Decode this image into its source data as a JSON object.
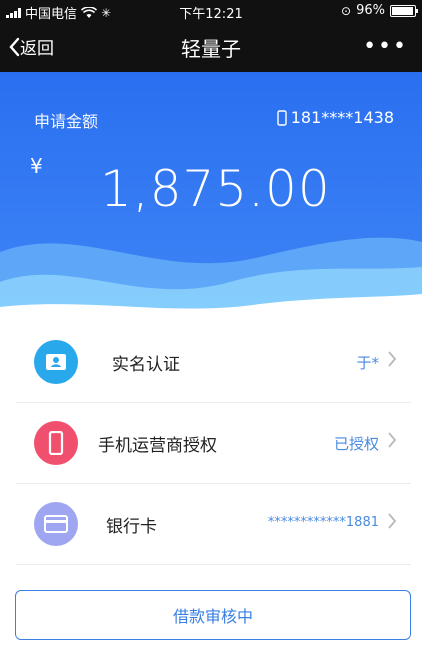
{
  "status_bar": {
    "carrier": "中国电信",
    "time": "下午12:21",
    "battery_pct": "96%",
    "battery_level": 0.96
  },
  "nav": {
    "back_label": "返回",
    "title": "轻量子",
    "more_label": "•••"
  },
  "header": {
    "label": "申请金额",
    "phone": "181****1438",
    "currency": "¥",
    "amount": "1,875.00"
  },
  "items": [
    {
      "name": "实名认证",
      "value": "于*",
      "icon": "id-card-icon",
      "color": "#2aa8ec"
    },
    {
      "name": "手机运营商授权",
      "value": "已授权",
      "icon": "mobile-phone-icon",
      "color": "#f0506e"
    },
    {
      "name": "银行卡",
      "value": "************1881",
      "icon": "bank-card-icon",
      "color": "#9ea6f2"
    }
  ],
  "button_label": "借款审核中",
  "colors": {
    "primary": "#2a6ff0",
    "accent_text": "#4a8ae0",
    "button_border": "#3a7fe4"
  }
}
